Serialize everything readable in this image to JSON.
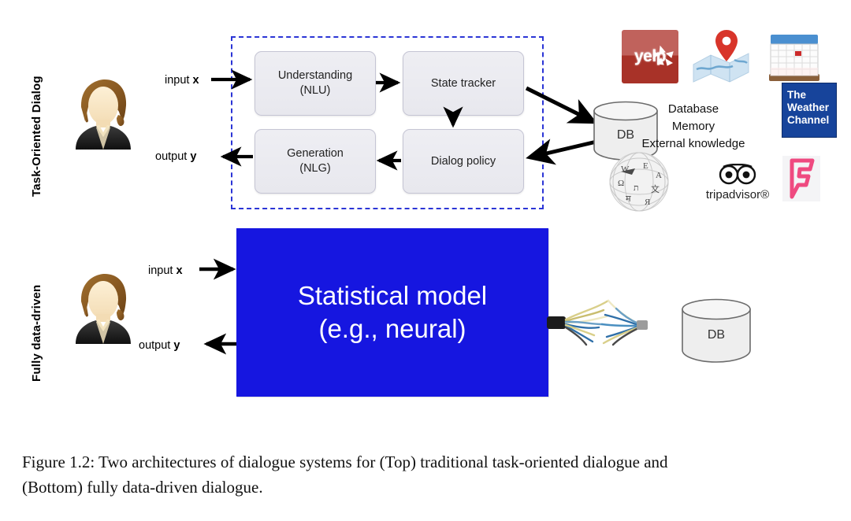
{
  "figure": {
    "rows": [
      {
        "id": "top",
        "side_label": "Task-Oriented Dialog"
      },
      {
        "id": "bottom",
        "side_label": "Fully data-driven"
      }
    ]
  },
  "top_row": {
    "side_label": "Task-Oriented Dialog",
    "avatar_name": "user-avatar",
    "input_label": "input",
    "input_var": "x",
    "output_label": "output",
    "output_var": "y",
    "pipeline_boxes": [
      {
        "name": "understanding",
        "line1": "Understanding",
        "line2": "(NLU)"
      },
      {
        "name": "state-tracker",
        "line1": "State tracker",
        "line2": ""
      },
      {
        "name": "generation",
        "line1": "Generation",
        "line2": "(NLG)"
      },
      {
        "name": "dialog-policy",
        "line1": "Dialog policy",
        "line2": ""
      }
    ],
    "database_label": "DB",
    "knowledge_sources": [
      "Database",
      "Memory",
      "External knowledge"
    ],
    "logos": [
      {
        "name": "yelp-logo",
        "text": "yelp"
      },
      {
        "name": "maps-logo",
        "text": ""
      },
      {
        "name": "calendar-logo",
        "text": ""
      },
      {
        "name": "weather-channel-logo",
        "line1": "The",
        "line2": "Weather",
        "line3": "Channel"
      },
      {
        "name": "wikipedia-logo",
        "text": ""
      },
      {
        "name": "tripadvisor-logo",
        "text": "tripadvisor®"
      },
      {
        "name": "foursquare-logo",
        "text": ""
      }
    ]
  },
  "bottom_row": {
    "side_label": "Fully data-driven",
    "avatar_name": "user-avatar",
    "input_label": "input",
    "input_var": "x",
    "output_label": "output",
    "output_var": "y",
    "model_box": {
      "line1": "Statistical model",
      "line2": "(e.g., neural)"
    },
    "database_label": "DB"
  },
  "caption": {
    "line1": "Figure 1.2: Two architectures of dialogue systems for (Top) traditional task-oriented dialogue and",
    "line2": "(Bottom) fully data-driven dialogue."
  },
  "colors": {
    "dashed_border": "#2b35d6",
    "model_box_fill": "#1616e0",
    "module_fill": "#eeeef3",
    "weather_blue": "#17449b",
    "yelp_red": "#a83228",
    "foursquare_pink": "#ef4a80"
  }
}
